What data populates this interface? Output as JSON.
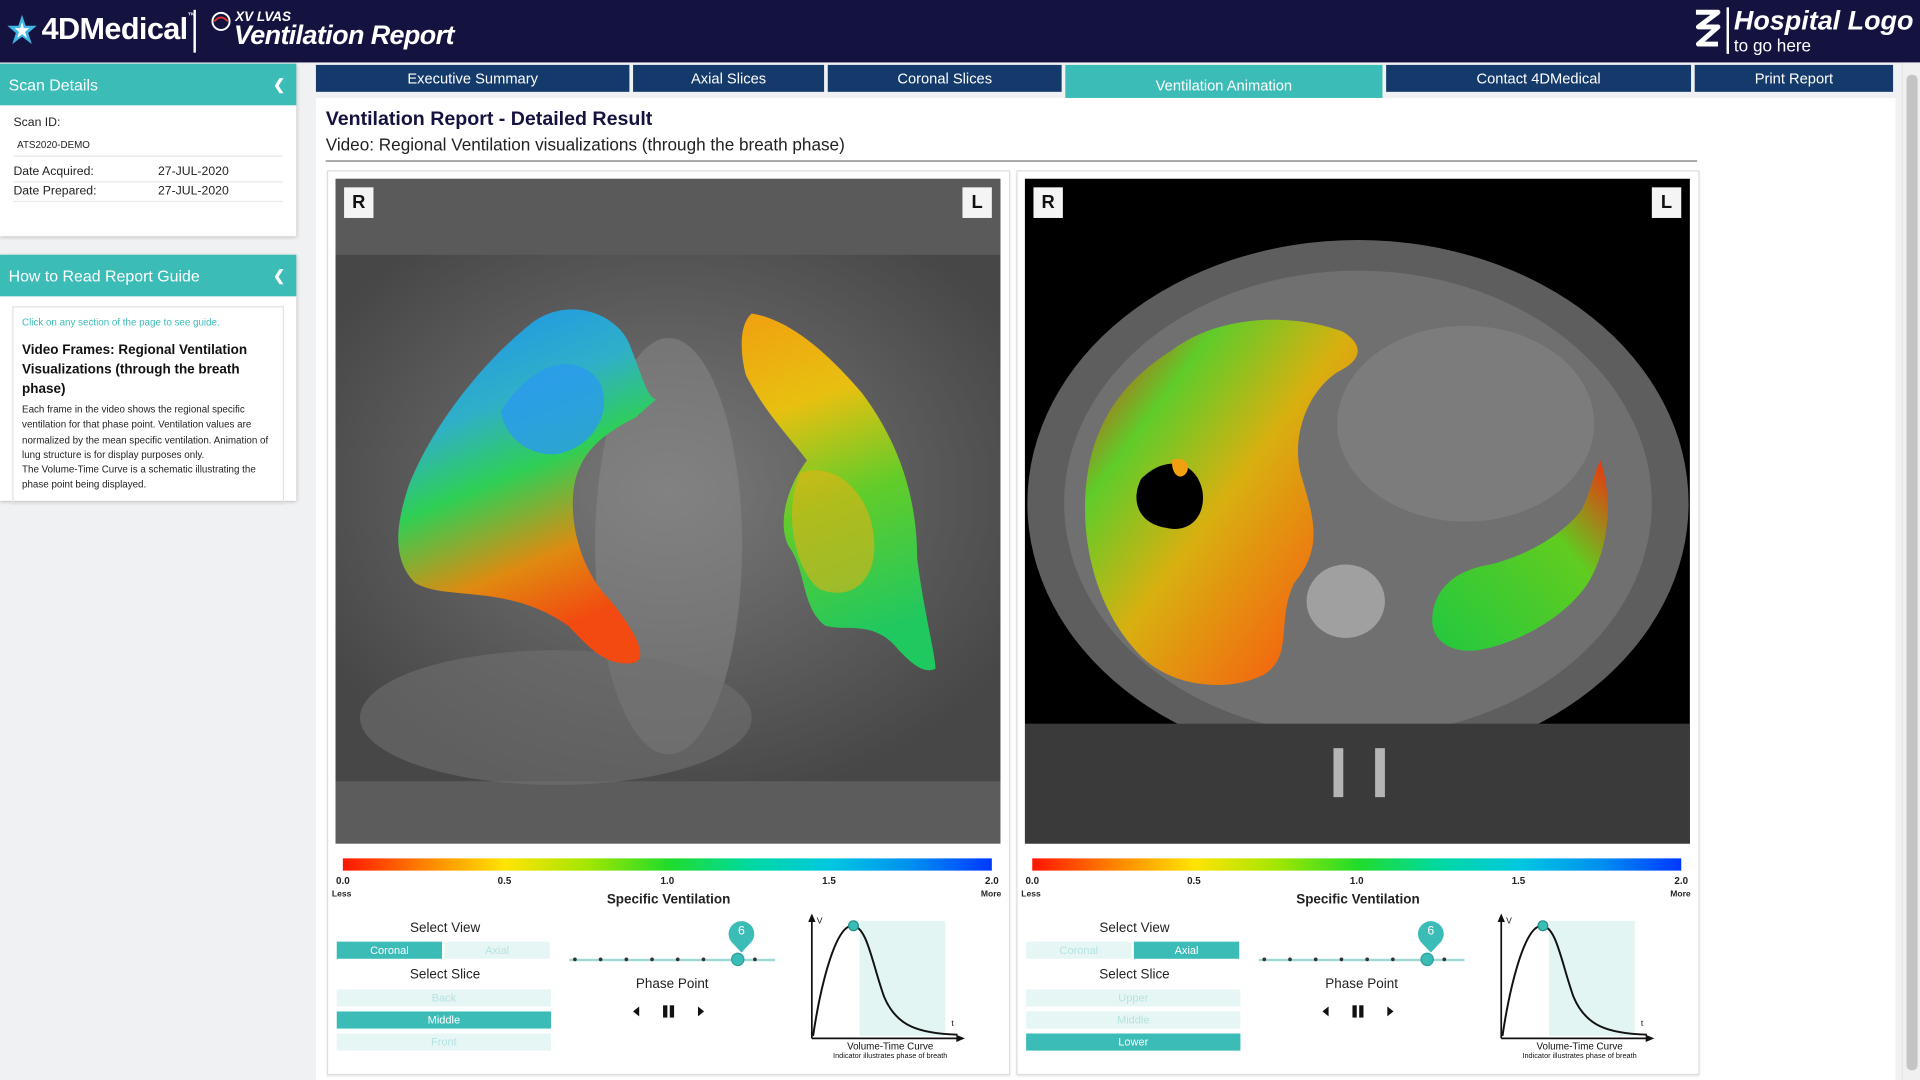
{
  "header": {
    "brand_name": "4DMedical",
    "brand_tm": "™",
    "product_prefix": "XV LVAS",
    "product_title": "Ventilation Report",
    "hospital_logo_line1": "Hospital Logo",
    "hospital_logo_line2": "to go here"
  },
  "sidebar": {
    "scan_details": {
      "title": "Scan Details",
      "scan_id_label": "Scan ID:",
      "scan_id_value": "ATS2020-DEMO",
      "date_acquired_label": "Date Acquired:",
      "date_acquired_value": "27-JUL-2020",
      "date_prepared_label": "Date Prepared:",
      "date_prepared_value": "27-JUL-2020"
    },
    "guide": {
      "title": "How to Read Report Guide",
      "hint": "Click on any section of the page to see guide.",
      "heading": "Video Frames: Regional Ventilation Visualizations (through the breath phase)",
      "body1": "Each frame in the video shows the regional specific ventilation for that phase point. Ventilation values are normalized by the mean specific ventilation. Animation of lung structure is for display purposes only.",
      "body2": "The Volume-Time Curve is a schematic illustrating the phase point being displayed."
    }
  },
  "tabs": [
    {
      "label": "Executive Summary",
      "active": false
    },
    {
      "label": "Axial Slices",
      "active": false
    },
    {
      "label": "Coronal Slices",
      "active": false
    },
    {
      "label": "Ventilation Animation",
      "active": true
    },
    {
      "label": "Contact 4DMedical",
      "active": false
    },
    {
      "label": "Print Report",
      "active": false
    }
  ],
  "main": {
    "title": "Ventilation Report - Detailed Result",
    "subtitle": "Video: Regional Ventilation visualizations (through the breath phase)"
  },
  "colorbar": {
    "ticks": [
      "0.0",
      "0.5",
      "1.0",
      "1.5",
      "2.0"
    ],
    "less_label": "Less",
    "more_label": "More",
    "title": "Specific Ventilation"
  },
  "panels": [
    {
      "view": "coronal",
      "orient_left": "R",
      "orient_right": "L",
      "select_view_label": "Select View",
      "view_options": [
        {
          "label": "Coronal",
          "selected": true
        },
        {
          "label": "Axial",
          "selected": false
        }
      ],
      "select_slice_label": "Select Slice",
      "slice_options": [
        {
          "label": "Back",
          "selected": false
        },
        {
          "label": "Middle",
          "selected": true
        },
        {
          "label": "Front",
          "selected": false
        }
      ],
      "phase_point": "6",
      "phase_label": "Phase Point",
      "curve_title": "Volume-Time Curve",
      "curve_subtitle": "Indicator illustrates phase of breath",
      "axis_v": "V",
      "axis_t": "t"
    },
    {
      "view": "axial",
      "orient_left": "R",
      "orient_right": "L",
      "select_view_label": "Select View",
      "view_options": [
        {
          "label": "Coronal",
          "selected": false
        },
        {
          "label": "Axial",
          "selected": true
        }
      ],
      "select_slice_label": "Select Slice",
      "slice_options": [
        {
          "label": "Upper",
          "selected": false
        },
        {
          "label": "Middle",
          "selected": false
        },
        {
          "label": "Lower",
          "selected": true
        }
      ],
      "phase_point": "6",
      "phase_label": "Phase Point",
      "curve_title": "Volume-Time Curve",
      "curve_subtitle": "Indicator illustrates phase of breath",
      "axis_v": "V",
      "axis_t": "t"
    }
  ],
  "colors": {
    "navy": "#14123f",
    "teal": "#3cbcb6",
    "tab_blue": "#14396b"
  }
}
